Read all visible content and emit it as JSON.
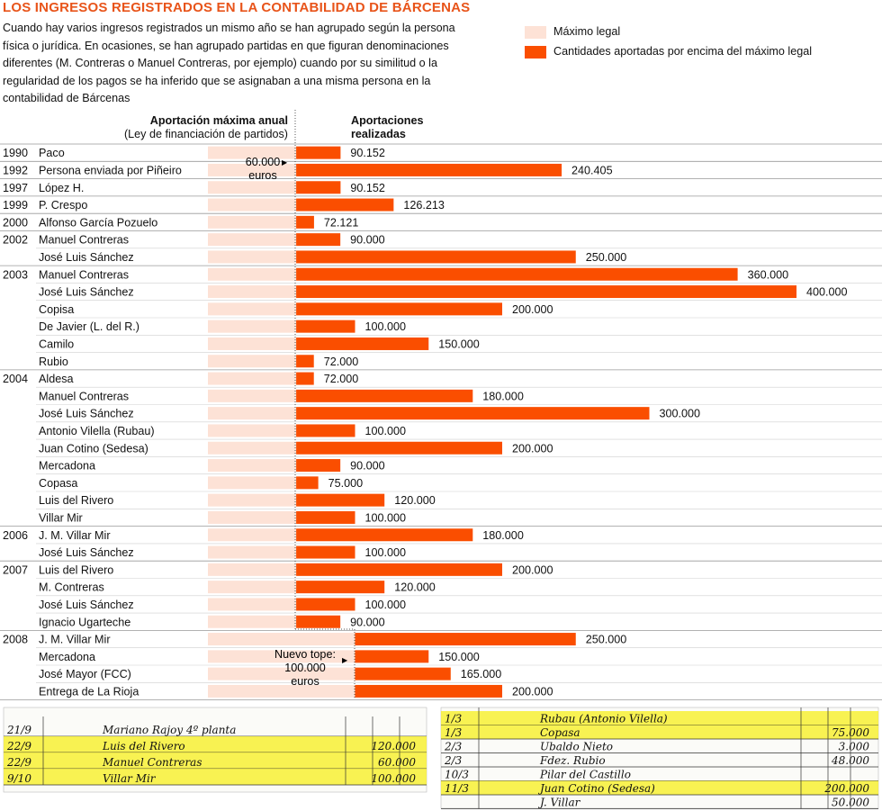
{
  "title": "LOS INGRESOS REGISTRADOS EN LA CONTABILIDAD DE BÁRCENAS",
  "intro": "Cuando hay varios ingresos registrados un mismo año se han agrupado según la persona física o jurídica. En ocasiones, se han agrupado partidas en que figuran denominaciones diferentes (M. Contreras o Manuel Contreras, por ejemplo) cuando por su similitud o la regularidad de los pagos se ha inferido que se asignaban a una misma persona en la contabilidad de Bárcenas",
  "legend": {
    "max_legal": "Máximo legal",
    "excess": "Cantidades aportadas por encima del máximo legal"
  },
  "colors": {
    "accent": "#fa4e00",
    "light": "#fde2d6",
    "title": "#e8541a",
    "highlight": "#f7f035"
  },
  "headers": {
    "max_title": "Aportación máxima anual",
    "max_sub": "(Ley de financiación de partidos)",
    "apor_1": "Aportaciones",
    "apor_2": "realizadas"
  },
  "annotations": {
    "limit_1": "60.000",
    "limit_1_unit": "euros",
    "limit_2": "Nuevo tope:",
    "limit_2_value": "100.000",
    "limit_2_unit": "euros"
  },
  "chart_data": {
    "type": "bar",
    "title": "LOS INGRESOS REGISTRADOS EN LA CONTABILIDAD DE BÁRCENAS",
    "series": [
      {
        "name": "Máximo legal",
        "values": [
          60000,
          60000,
          60000,
          60000,
          60000,
          60000,
          60000,
          60000,
          60000,
          60000,
          60000,
          60000,
          60000,
          60000,
          60000,
          60000,
          60000,
          60000,
          60000,
          60000,
          60000,
          60000,
          60000,
          60000,
          60000,
          60000,
          60000,
          60000,
          60000,
          100000,
          100000,
          100000,
          100000
        ]
      },
      {
        "name": "Cantidades aportadas por encima del máximo legal",
        "values": [
          90152,
          240405,
          90152,
          126213,
          72121,
          90000,
          250000,
          360000,
          400000,
          200000,
          100000,
          150000,
          72000,
          72000,
          180000,
          300000,
          100000,
          200000,
          90000,
          75000,
          120000,
          100000,
          180000,
          100000,
          200000,
          120000,
          100000,
          90000,
          250000,
          150000,
          165000,
          200000
        ]
      }
    ],
    "rows": [
      {
        "year": "1990",
        "name": "Paco",
        "value": 90152,
        "label": "90.152",
        "limit": 60000
      },
      {
        "year": "1992",
        "name": "Persona enviada por Piñeiro",
        "value": 240405,
        "label": "240.405",
        "limit": 60000
      },
      {
        "year": "1997",
        "name": "López H.",
        "value": 90152,
        "label": "90.152",
        "limit": 60000
      },
      {
        "year": "1999",
        "name": "P. Crespo",
        "value": 126213,
        "label": "126.213",
        "limit": 60000
      },
      {
        "year": "2000",
        "name": "Alfonso García Pozuelo",
        "value": 72121,
        "label": "72.121",
        "limit": 60000
      },
      {
        "year": "2002",
        "name": "Manuel Contreras",
        "value": 90000,
        "label": "90.000",
        "limit": 60000
      },
      {
        "year": "",
        "name": "José Luis Sánchez",
        "value": 250000,
        "label": "250.000",
        "limit": 60000
      },
      {
        "year": "2003",
        "name": "Manuel Contreras",
        "value": 360000,
        "label": "360.000",
        "limit": 60000
      },
      {
        "year": "",
        "name": "José Luis Sánchez",
        "value": 400000,
        "label": "400.000",
        "limit": 60000
      },
      {
        "year": "",
        "name": "Copisa",
        "value": 200000,
        "label": "200.000",
        "limit": 60000
      },
      {
        "year": "",
        "name": "De Javier (L. del R.)",
        "value": 100000,
        "label": "100.000",
        "limit": 60000
      },
      {
        "year": "",
        "name": "Camilo",
        "value": 150000,
        "label": "150.000",
        "limit": 60000
      },
      {
        "year": "",
        "name": "Rubio",
        "value": 72000,
        "label": "72.000",
        "limit": 60000
      },
      {
        "year": "2004",
        "name": "Aldesa",
        "value": 72000,
        "label": "72.000",
        "limit": 60000
      },
      {
        "year": "",
        "name": "Manuel Contreras",
        "value": 180000,
        "label": "180.000",
        "limit": 60000
      },
      {
        "year": "",
        "name": "José Luis Sánchez",
        "value": 300000,
        "label": "300.000",
        "limit": 60000
      },
      {
        "year": "",
        "name": "Antonio Vilella (Rubau)",
        "value": 100000,
        "label": "100.000",
        "limit": 60000
      },
      {
        "year": "",
        "name": "Juan Cotino (Sedesa)",
        "value": 200000,
        "label": "200.000",
        "limit": 60000
      },
      {
        "year": "",
        "name": "Mercadona",
        "value": 90000,
        "label": "90.000",
        "limit": 60000
      },
      {
        "year": "",
        "name": "Copasa",
        "value": 75000,
        "label": "75.000",
        "limit": 60000
      },
      {
        "year": "",
        "name": "Luis del Rivero",
        "value": 120000,
        "label": "120.000",
        "limit": 60000
      },
      {
        "year": "",
        "name": "Villar Mir",
        "value": 100000,
        "label": "100.000",
        "limit": 60000
      },
      {
        "year": "2006",
        "name": "J. M. Villar Mir",
        "value": 180000,
        "label": "180.000",
        "limit": 60000
      },
      {
        "year": "",
        "name": "José Luis Sánchez",
        "value": 100000,
        "label": "100.000",
        "limit": 60000
      },
      {
        "year": "2007",
        "name": "Luis del Rivero",
        "value": 200000,
        "label": "200.000",
        "limit": 60000
      },
      {
        "year": "",
        "name": "M. Contreras",
        "value": 120000,
        "label": "120.000",
        "limit": 60000
      },
      {
        "year": "",
        "name": "José Luis Sánchez",
        "value": 100000,
        "label": "100.000",
        "limit": 60000
      },
      {
        "year": "",
        "name": "Ignacio Ugarteche",
        "value": 90000,
        "label": "90.000",
        "limit": 60000
      },
      {
        "year": "2008",
        "name": "J. M. Villar Mir",
        "value": 250000,
        "label": "250.000",
        "limit": 100000
      },
      {
        "year": "",
        "name": "Mercadona",
        "value": 150000,
        "label": "150.000",
        "limit": 100000
      },
      {
        "year": "",
        "name": "José Mayor (FCC)",
        "value": 165000,
        "label": "165.000",
        "limit": 100000
      },
      {
        "year": "",
        "name": "Entrega de La Rioja",
        "value": 200000,
        "label": "200.000",
        "limit": 100000
      }
    ],
    "year_groups_end": [
      0,
      1,
      2,
      3,
      4,
      6,
      12,
      21,
      23,
      27,
      31
    ],
    "xlim": [
      0,
      400000
    ],
    "legend": "top-right"
  },
  "ledger_left": [
    {
      "date": "21/9",
      "desc": "Mariano Rajoy 4º planta",
      "amount": "",
      "hl": false
    },
    {
      "date": "22/9",
      "desc": "Luis del Rivero",
      "amount": "120.000",
      "hl": true
    },
    {
      "date": "22/9",
      "desc": "Manuel Contreras",
      "amount": "60.000",
      "hl": true
    },
    {
      "date": "9/10",
      "desc": "Villar Mir",
      "amount": "100.000",
      "hl": true
    }
  ],
  "ledger_right": [
    {
      "date": "1/3",
      "desc": "Rubau (Antonio Vilella)",
      "amount": "",
      "hl": true
    },
    {
      "date": "1/3",
      "desc": "Copasa",
      "amount": "75.000",
      "hl": true
    },
    {
      "date": "2/3",
      "desc": "Ubaldo Nieto",
      "amount": "3.000",
      "hl": false
    },
    {
      "date": "2/3",
      "desc": "Fdez. Rubio",
      "amount": "48.000",
      "hl": false
    },
    {
      "date": "10/3",
      "desc": "Pilar del Castillo",
      "amount": "",
      "hl": false
    },
    {
      "date": "11/3",
      "desc": "Juan Cotino (Sedesa)",
      "amount": "200.000",
      "hl": true
    },
    {
      "date": "",
      "desc": "J. Villar",
      "amount": "50.000",
      "hl": false
    }
  ]
}
